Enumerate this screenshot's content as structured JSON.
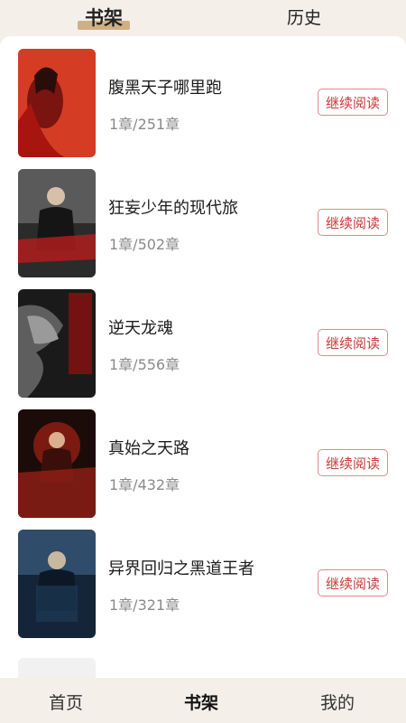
{
  "top_tabs": {
    "shelf": "书架",
    "history": "历史"
  },
  "books": [
    {
      "title": "腹黑天子哪里跑",
      "progress": "1章/251章",
      "action": "继续阅读",
      "cover_text": "腹黑天子哪里跑"
    },
    {
      "title": "狂妄少年的现代旅",
      "progress": "1章/502章",
      "action": "继续阅读",
      "cover_text": "狂妄少年的现代旅"
    },
    {
      "title": "逆天龙魂",
      "progress": "1章/556章",
      "action": "继续阅读",
      "cover_text": "逆天龙魂"
    },
    {
      "title": "真始之天路",
      "progress": "1章/432章",
      "action": "继续阅读",
      "cover_text": "真始之天路"
    },
    {
      "title": "异界回归之黑道王者",
      "progress": "1章/321章",
      "action": "继续阅读",
      "cover_text": "异界回归之黑道王者"
    }
  ],
  "bottom_nav": {
    "home": "首页",
    "shelf": "书架",
    "mine": "我的"
  },
  "colors": {
    "accent": "#c9393b",
    "tab_underline": "#c8a574",
    "background": "#f4efe9"
  }
}
